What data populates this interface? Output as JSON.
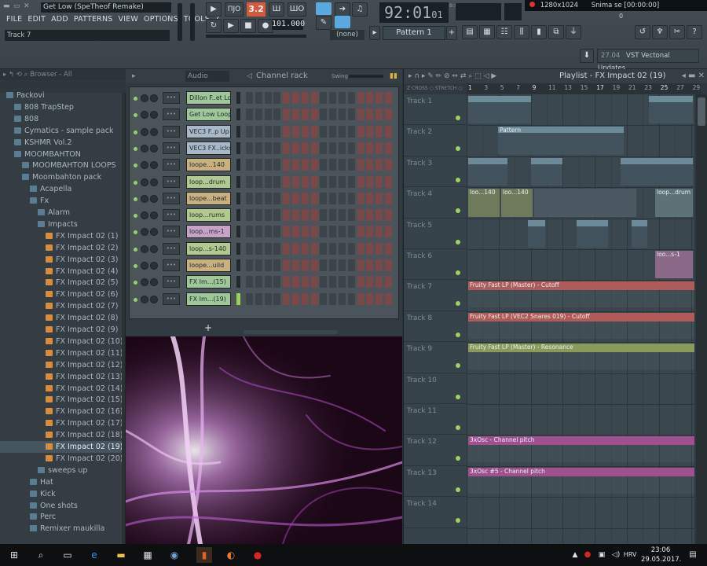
{
  "window": {
    "song_title": "Get Low (SpeTheof Remake)"
  },
  "menu": [
    "FILE",
    "EDIT",
    "ADD",
    "PATTERNS",
    "VIEW",
    "OPTIONS",
    "TOOLS",
    "?"
  ],
  "hint": "Track 7",
  "transport": {
    "time": "92:01",
    "time_small": "01",
    "tempo": "101.000",
    "pat_number": "3.2",
    "pattern": "Pattern 1",
    "snap": "(none)",
    "time_label": "B:S:T"
  },
  "system": {
    "resolution": "1280x1024",
    "recording": "Snima se [00:00:00]",
    "counter": "0"
  },
  "news": {
    "date": "27.04",
    "text": "VST Vectonal Updates"
  },
  "browser": {
    "title": "Browser - All",
    "items": [
      {
        "label": "Packovi",
        "indent": 0,
        "kind": "folder"
      },
      {
        "label": "808 TrapStep",
        "indent": 1,
        "kind": "folder"
      },
      {
        "label": "808",
        "indent": 1,
        "kind": "folder"
      },
      {
        "label": "Cymatics - sample pack",
        "indent": 1,
        "kind": "folder"
      },
      {
        "label": "KSHMR Vol.2",
        "indent": 1,
        "kind": "folder"
      },
      {
        "label": "MOOMBAHTON",
        "indent": 1,
        "kind": "folder"
      },
      {
        "label": "MOOMBAHTON LOOPS",
        "indent": 2,
        "kind": "folder"
      },
      {
        "label": "Moombahton pack",
        "indent": 2,
        "kind": "folder"
      },
      {
        "label": "Acapella",
        "indent": 3,
        "kind": "folder"
      },
      {
        "label": "Fx",
        "indent": 3,
        "kind": "folder"
      },
      {
        "label": "Alarm",
        "indent": 4,
        "kind": "folder"
      },
      {
        "label": "Impacts",
        "indent": 4,
        "kind": "folder"
      },
      {
        "label": "FX Impact 02 (1)",
        "indent": 5,
        "kind": "file"
      },
      {
        "label": "FX Impact 02 (2)",
        "indent": 5,
        "kind": "file"
      },
      {
        "label": "FX Impact 02 (3)",
        "indent": 5,
        "kind": "file"
      },
      {
        "label": "FX Impact 02 (4)",
        "indent": 5,
        "kind": "file"
      },
      {
        "label": "FX Impact 02 (5)",
        "indent": 5,
        "kind": "file"
      },
      {
        "label": "FX Impact 02 (6)",
        "indent": 5,
        "kind": "file"
      },
      {
        "label": "FX Impact 02 (7)",
        "indent": 5,
        "kind": "file"
      },
      {
        "label": "FX Impact 02 (8)",
        "indent": 5,
        "kind": "file"
      },
      {
        "label": "FX Impact 02 (9)",
        "indent": 5,
        "kind": "file"
      },
      {
        "label": "FX Impact 02 (10)",
        "indent": 5,
        "kind": "file"
      },
      {
        "label": "FX Impact 02 (11)",
        "indent": 5,
        "kind": "file"
      },
      {
        "label": "FX Impact 02 (12)",
        "indent": 5,
        "kind": "file"
      },
      {
        "label": "FX Impact 02 (13)",
        "indent": 5,
        "kind": "file"
      },
      {
        "label": "FX Impact 02 (14)",
        "indent": 5,
        "kind": "file"
      },
      {
        "label": "FX Impact 02 (15)",
        "indent": 5,
        "kind": "file"
      },
      {
        "label": "FX Impact 02 (16)",
        "indent": 5,
        "kind": "file"
      },
      {
        "label": "FX Impact 02 (17)",
        "indent": 5,
        "kind": "file"
      },
      {
        "label": "FX Impact 02 (18)",
        "indent": 5,
        "kind": "file"
      },
      {
        "label": "FX Impact 02 (19)",
        "indent": 5,
        "kind": "file",
        "selected": true
      },
      {
        "label": "FX Impact 02 (20)",
        "indent": 5,
        "kind": "file"
      },
      {
        "label": "sweeps up",
        "indent": 4,
        "kind": "folder"
      },
      {
        "label": "Hat",
        "indent": 3,
        "kind": "folder"
      },
      {
        "label": "Kick",
        "indent": 3,
        "kind": "folder"
      },
      {
        "label": "One shots",
        "indent": 3,
        "kind": "folder"
      },
      {
        "label": "Perc",
        "indent": 3,
        "kind": "folder"
      },
      {
        "label": "Remixer maukilla",
        "indent": 3,
        "kind": "folder"
      }
    ]
  },
  "channel_rack": {
    "title": "Channel rack",
    "filter": "Audio",
    "swing_label": "Swing",
    "add_label": "+",
    "channels": [
      {
        "name": "Dillon F..et Low",
        "color": "#9fc79a"
      },
      {
        "name": "Get Low Loop",
        "color": "#9fc79a"
      },
      {
        "name": "VEC3 F..p Up 21",
        "color": "#a9b8c8"
      },
      {
        "name": "VEC3 FX..icks 04",
        "color": "#a9b8c8"
      },
      {
        "name": "loope...140",
        "color": "#c9b07f"
      },
      {
        "name": "loop...drum",
        "color": "#b0c98f"
      },
      {
        "name": "loope...beat",
        "color": "#c9b07f"
      },
      {
        "name": "loop...rums",
        "color": "#b0c98f"
      },
      {
        "name": "loop...ms-1",
        "color": "#c6a2c8"
      },
      {
        "name": "loop...s-140",
        "color": "#b0c98f"
      },
      {
        "name": "loope...uild",
        "color": "#c9b07f"
      },
      {
        "name": "FX Im...(15)",
        "color": "#9fc79a"
      },
      {
        "name": "FX Im...(19)",
        "color": "#9fc79a"
      }
    ]
  },
  "playlist": {
    "title": "Playlist - FX Impact 02 (19)",
    "ruler": [
      "1",
      "3",
      "5",
      "7",
      "9",
      "11",
      "13",
      "15",
      "17",
      "19",
      "21",
      "23",
      "25",
      "27",
      "29"
    ],
    "tracks": [
      "Track 1",
      "Track 2",
      "Track 3",
      "Track 4",
      "Track 5",
      "Track 6",
      "Track 7",
      "Track 8",
      "Track 9",
      "Track 10",
      "Track 11",
      "Track 12",
      "Track 13",
      "Track 14"
    ],
    "automation": [
      {
        "track": 7,
        "label": "Fruity Fast LP (Master) - Cutoff",
        "color": "#b05a5a"
      },
      {
        "track": 8,
        "label": "Fruity Fast LP (VEC2 Snares 019) - Cutoff",
        "color": "#b05a5a"
      },
      {
        "track": 9,
        "label": "Fruity Fast LP (Master) - Resonance",
        "color": "#8a9a5a"
      },
      {
        "track": 12,
        "label": "3xOsc - Channel pitch",
        "color": "#a1508f"
      },
      {
        "track": 13,
        "label": "3xOsc #5 - Channel pitch",
        "color": "#a1508f"
      }
    ],
    "clips": [
      {
        "track": 2,
        "label": "Pattern"
      },
      {
        "track": 4,
        "label": "loo...140"
      },
      {
        "track": 4,
        "label": "loo...140"
      },
      {
        "track": 4,
        "label": "loop...drum"
      },
      {
        "track": 6,
        "label": "loo...s-1"
      }
    ]
  },
  "taskbar": {
    "lang": "HRV",
    "time": "23:06",
    "date": "29.05.2017."
  }
}
